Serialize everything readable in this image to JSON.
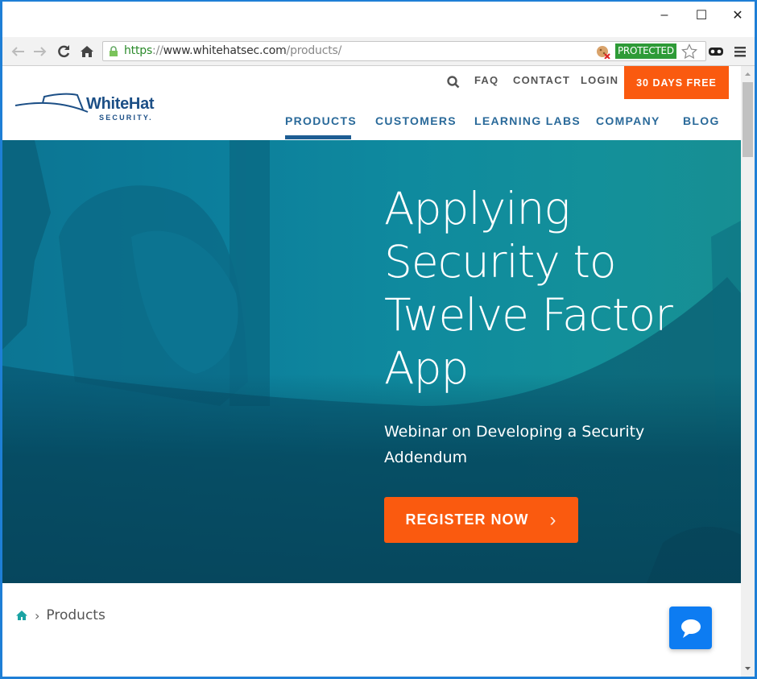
{
  "window": {
    "controls": {
      "minimize": "–",
      "maximize": "☐",
      "close": "✕"
    }
  },
  "browser": {
    "url_scheme": "https",
    "url_separator": "://",
    "url_host": "www.whitehatsec.com",
    "url_path": "/products/",
    "protected_badge": "PROTECTED"
  },
  "header": {
    "logo_name": "WhiteHat",
    "logo_sub": "SECURITY.",
    "utility": {
      "faq": "FAQ",
      "contact": "CONTACT",
      "login": "LOGIN",
      "cta": "30 DAYS FREE"
    },
    "nav": [
      {
        "label": "PRODUCTS",
        "active": true
      },
      {
        "label": "CUSTOMERS",
        "active": false
      },
      {
        "label": "LEARNING LABS",
        "active": false
      },
      {
        "label": "COMPANY",
        "active": false
      },
      {
        "label": "BLOG",
        "active": false
      }
    ]
  },
  "hero": {
    "title_lines": [
      "Applying",
      "Security to",
      "Twelve Factor",
      "App"
    ],
    "subtitle_lines": [
      "Webinar on Developing a Security",
      "Addendum"
    ],
    "button_label": "REGISTER NOW",
    "button_arrow": "›",
    "slides": 2,
    "active_slide": 1
  },
  "breadcrumb": {
    "separator": "›",
    "current": "Products"
  },
  "colors": {
    "accent_orange": "#fa5a0f",
    "nav_blue": "#2a6a9a",
    "chat_blue": "#0d7cf2",
    "protected_green": "#2e9b37"
  }
}
